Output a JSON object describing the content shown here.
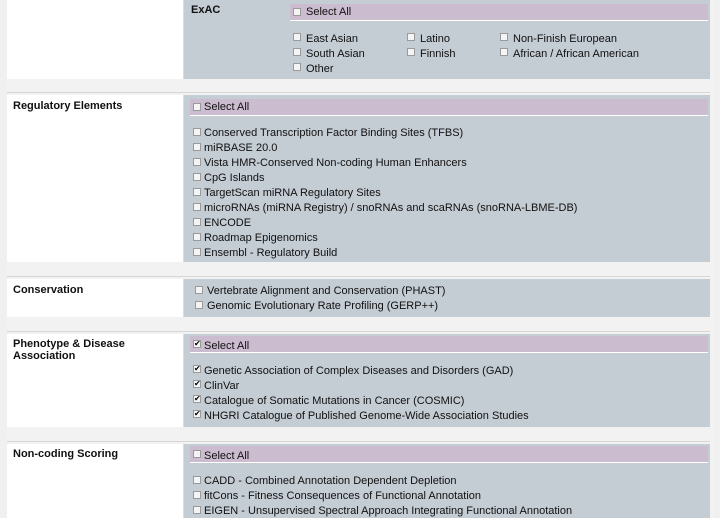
{
  "exac": {
    "title": "ExAC",
    "select_all": "Select All",
    "items": [
      "East Asian",
      "Latino",
      "Non-Finish European",
      "South Asian",
      "Finnish",
      "African / African American",
      "Other"
    ]
  },
  "regulatory": {
    "title": "Regulatory Elements",
    "select_all": "Select All",
    "items": [
      "Conserved Transcription Factor Binding Sites (TFBS)",
      "miRBASE 20.0",
      "Vista HMR-Conserved Non-coding Human Enhancers",
      "CpG Islands",
      "TargetScan miRNA Regulatory Sites",
      "microRNAs (miRNA Registry) / snoRNAs and scaRNAs (snoRNA-LBME-DB)",
      "ENCODE",
      "Roadmap Epigenomics",
      "Ensembl - Regulatory Build"
    ]
  },
  "conservation": {
    "title": "Conservation",
    "items": [
      "Vertebrate Alignment and Conservation (PHAST)",
      "Genomic Evolutionary Rate Profiling (GERP++)"
    ]
  },
  "phenotype": {
    "title": "Phenotype & Disease Association",
    "select_all": "Select All",
    "items": [
      "Genetic Association of Complex Diseases and Disorders (GAD)",
      "ClinVar",
      "Catalogue of Somatic Mutations in Cancer (COSMIC)",
      "NHGRI Catalogue of Published Genome-Wide Association Studies"
    ]
  },
  "noncoding": {
    "title": "Non-coding Scoring",
    "select_all": "Select All",
    "items": [
      "CADD - Combined Annotation Dependent Depletion",
      "fitCons - Fitness Consequences of Functional Annotation",
      "EIGEN - Unsupervised Spectral Approach Integrating Functional Annotation"
    ]
  }
}
